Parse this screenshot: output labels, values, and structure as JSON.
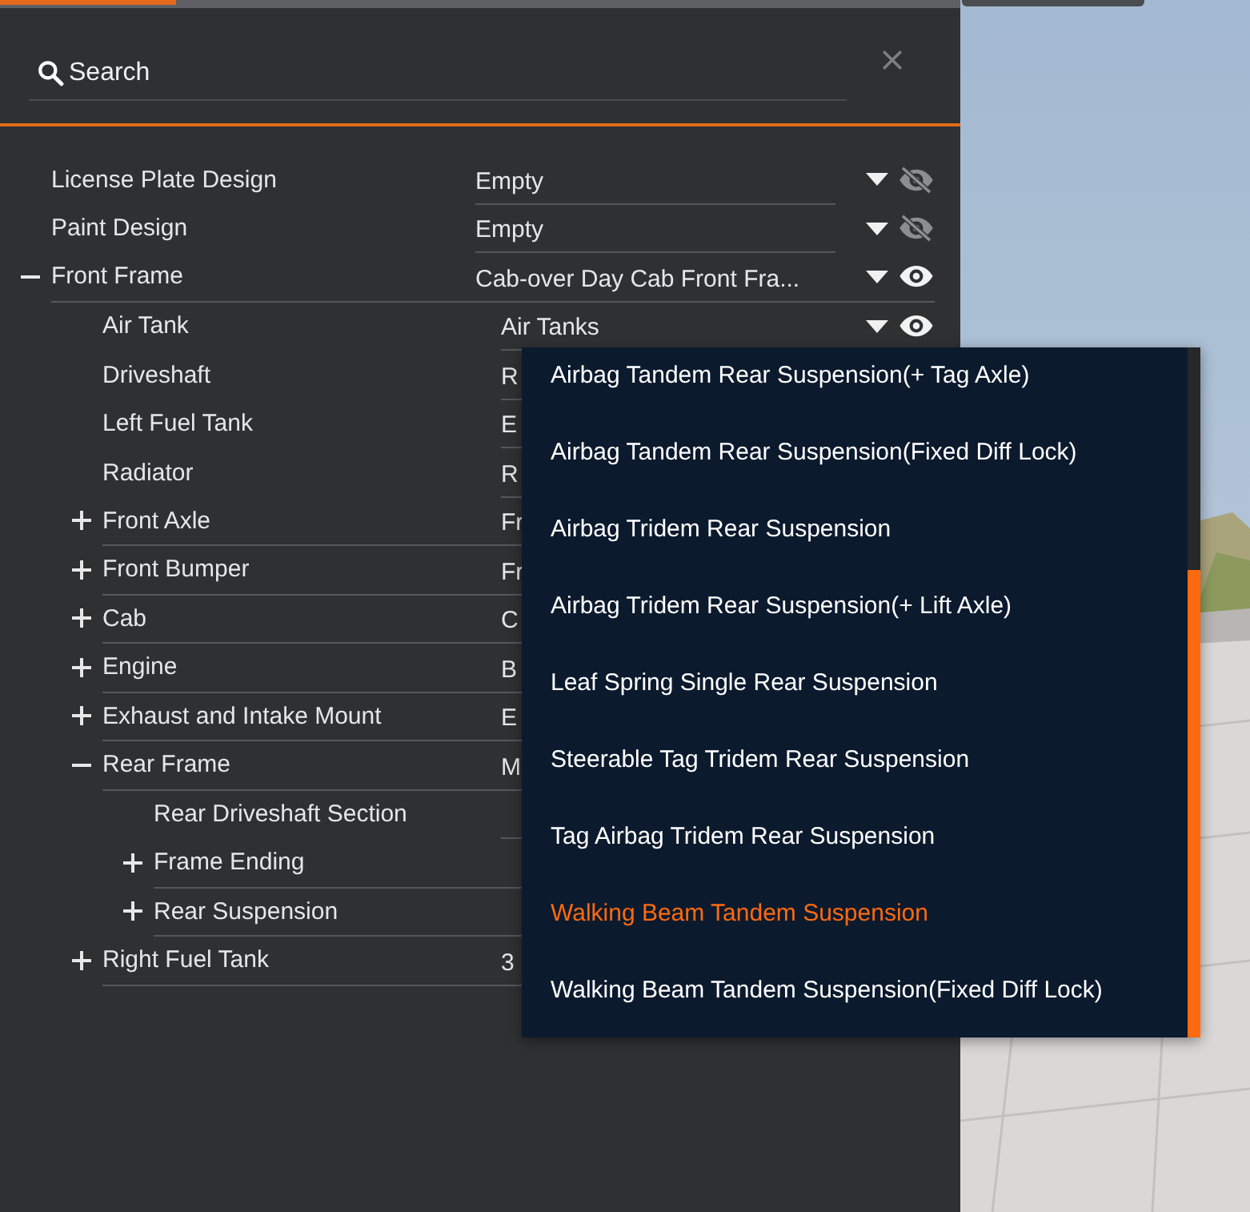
{
  "search": {
    "placeholder": "Search"
  },
  "tree": [
    {
      "name": "License Plate Design",
      "value": "Empty",
      "visible": false
    },
    {
      "name": "Paint Design",
      "value": "Empty",
      "visible": false
    },
    {
      "name": "Front Frame",
      "value": "Cab-over Day Cab Front Fra...",
      "visible": true,
      "expanded": true,
      "children": [
        {
          "name": "Air Tank",
          "value": "Air Tanks",
          "visible": true
        },
        {
          "name": "Driveshaft",
          "value": "R"
        },
        {
          "name": "Left Fuel Tank",
          "value": "E"
        },
        {
          "name": "Radiator",
          "value": "R"
        },
        {
          "name": "Front Axle",
          "value": "Fr",
          "expanded": false
        },
        {
          "name": "Front Bumper",
          "value": "Fr",
          "expanded": false
        },
        {
          "name": "Cab",
          "value": "C",
          "expanded": false
        },
        {
          "name": "Engine",
          "value": "B",
          "expanded": false
        },
        {
          "name": "Exhaust and Intake Mount",
          "value": "E",
          "expanded": false
        },
        {
          "name": "Rear Frame",
          "value": "M",
          "expanded": true,
          "children": [
            {
              "name": "Rear Driveshaft Section"
            },
            {
              "name": "Frame Ending",
              "expanded": false
            },
            {
              "name": "Rear Suspension",
              "expanded": false
            }
          ]
        },
        {
          "name": "Right Fuel Tank",
          "value": "3",
          "expanded": false
        }
      ]
    }
  ],
  "dropdown": {
    "options": [
      {
        "label": "Airbag Tandem Rear Suspension(+ Tag Axle)",
        "selected": false
      },
      {
        "label": "Airbag Tandem Rear Suspension(Fixed Diff Lock)",
        "selected": false
      },
      {
        "label": "Airbag Tridem Rear Suspension",
        "selected": false
      },
      {
        "label": "Airbag Tridem Rear Suspension(+ Lift Axle)",
        "selected": false
      },
      {
        "label": "Leaf Spring Single Rear Suspension",
        "selected": false
      },
      {
        "label": "Steerable Tag Tridem Rear Suspension",
        "selected": false
      },
      {
        "label": "Tag Airbag Tridem Rear Suspension",
        "selected": false
      },
      {
        "label": "Walking Beam Tandem Suspension",
        "selected": true
      },
      {
        "label": "Walking Beam Tandem Suspension(Fixed Diff Lock)",
        "selected": false
      }
    ]
  }
}
